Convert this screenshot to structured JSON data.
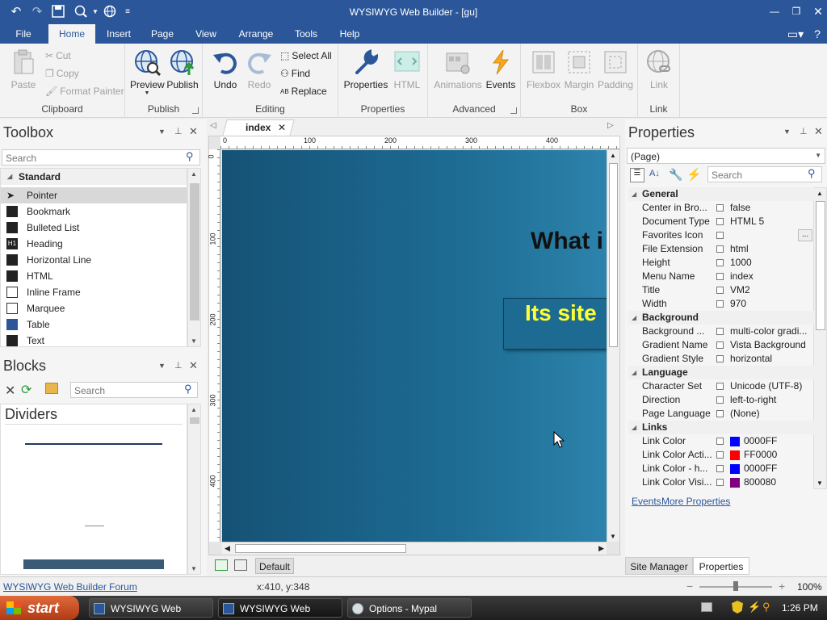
{
  "window": {
    "title": "WYSIWYG Web Builder - [gu]"
  },
  "menu_tabs": [
    "File",
    "Home",
    "Insert",
    "Page",
    "View",
    "Arrange",
    "Tools",
    "Help"
  ],
  "ribbon": {
    "clipboard": {
      "paste": "Paste",
      "cut": "Cut",
      "copy": "Copy",
      "format_painter": "Format Painter",
      "label": "Clipboard"
    },
    "publish": {
      "preview": "Preview",
      "publish": "Publish",
      "label": "Publish"
    },
    "editing": {
      "undo": "Undo",
      "redo": "Redo",
      "select_all": "Select All",
      "find": "Find",
      "replace": "Replace",
      "label": "Editing"
    },
    "properties": {
      "properties": "Properties",
      "html": "HTML",
      "label": "Properties"
    },
    "advanced": {
      "animations": "Animations",
      "events": "Events",
      "label": "Advanced"
    },
    "box": {
      "flexbox": "Flexbox",
      "margin": "Margin",
      "padding": "Padding",
      "label": "Box"
    },
    "link": {
      "link": "Link",
      "label": "Link"
    }
  },
  "toolbox": {
    "title": "Toolbox",
    "search_placeholder": "Search",
    "category": "Standard",
    "items": [
      "Pointer",
      "Bookmark",
      "Bulleted List",
      "Heading",
      "Horizontal Line",
      "HTML",
      "Inline Frame",
      "Marquee",
      "Table",
      "Text"
    ]
  },
  "blocks": {
    "title": "Blocks",
    "search_placeholder": "Search",
    "category": "Dividers"
  },
  "document": {
    "tab": "index",
    "ruler_h": [
      "0",
      "100",
      "200",
      "300",
      "400"
    ],
    "ruler_v": [
      "0",
      "100",
      "200",
      "300",
      "400"
    ],
    "heading_text": "What i",
    "banner_text": "Its site",
    "page_default": "Default"
  },
  "properties": {
    "title": "Properties",
    "selector": "(Page)",
    "search_placeholder": "Search",
    "categories": [
      {
        "name": "General",
        "rows": [
          {
            "name": "Center in Bro...",
            "value": "false"
          },
          {
            "name": "Document Type",
            "value": "HTML 5"
          },
          {
            "name": "Favorites Icon",
            "value": ""
          },
          {
            "name": "File Extension",
            "value": "html"
          },
          {
            "name": "Height",
            "value": "1000"
          },
          {
            "name": "Menu Name",
            "value": "index"
          },
          {
            "name": "Title",
            "value": "VM2"
          },
          {
            "name": "Width",
            "value": "970"
          }
        ]
      },
      {
        "name": "Background",
        "rows": [
          {
            "name": "Background ...",
            "value": "multi-color gradi..."
          },
          {
            "name": "Gradient Name",
            "value": "Vista Background"
          },
          {
            "name": "Gradient Style",
            "value": "horizontal"
          }
        ]
      },
      {
        "name": "Language",
        "rows": [
          {
            "name": "Character Set",
            "value": "Unicode (UTF-8)"
          },
          {
            "name": "Direction",
            "value": "left-to-right"
          },
          {
            "name": "Page Language",
            "value": "(None)"
          }
        ]
      },
      {
        "name": "Links",
        "rows": [
          {
            "name": "Link Color",
            "value": "0000FF",
            "swatch": "#0000FF"
          },
          {
            "name": "Link Color Acti...",
            "value": "FF0000",
            "swatch": "#FF0000"
          },
          {
            "name": "Link Color - h...",
            "value": "0000FF",
            "swatch": "#0000FF"
          },
          {
            "name": "Link Color Visi...",
            "value": "800080",
            "swatch": "#800080"
          }
        ]
      }
    ],
    "events_link": "Events",
    "more_properties_link": "More Properties",
    "bottom_tabs": [
      "Site Manager",
      "Properties"
    ]
  },
  "statusbar": {
    "forum_link": "WYSIWYG Web Builder Forum",
    "coords": "x:410, y:348",
    "zoom": "100%"
  },
  "taskbar": {
    "start": "start",
    "buttons": [
      "WYSIWYG Web Build...",
      "WYSIWYG Web Build...",
      "Options - Mypal"
    ],
    "clock": "1:26 PM"
  },
  "colors": {
    "accent": "#2b579a",
    "canvas_dark": "#1a5a7d",
    "banner_text": "#ffff33"
  }
}
